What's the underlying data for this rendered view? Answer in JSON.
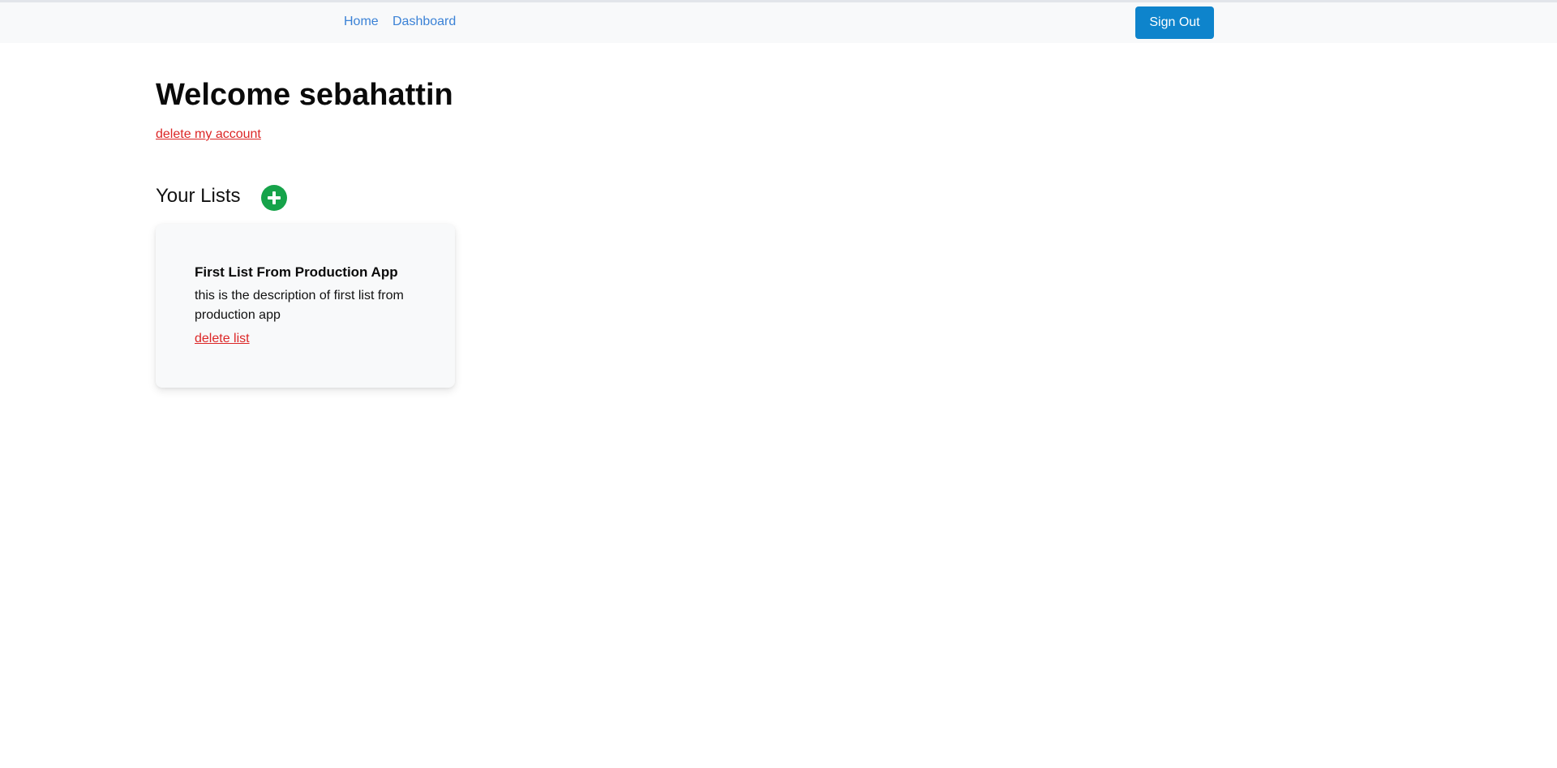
{
  "nav": {
    "home_label": "Home",
    "dashboard_label": "Dashboard",
    "signout_label": "Sign Out"
  },
  "main": {
    "welcome_text": "Welcome sebahattin",
    "delete_account_label": "delete my account",
    "lists_title": "Your Lists",
    "add_icon": "plus-circle-icon",
    "lists": [
      {
        "title": "First List From Production App",
        "description": "this is the description of first list from production app",
        "delete_label": "delete list"
      }
    ]
  },
  "colors": {
    "link": "#3b82d6",
    "primary_button": "#0e84cc",
    "danger": "#dc2626",
    "add_button": "#16a34a",
    "navbar_bg": "#f8f9fa",
    "card_bg": "#f8f9fa"
  }
}
